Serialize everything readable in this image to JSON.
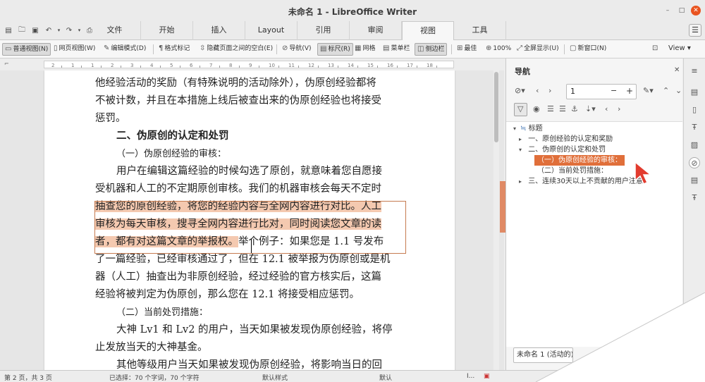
{
  "window": {
    "title": "未命名 1 - LibreOffice Writer"
  },
  "tabs": [
    "文件",
    "开始",
    "插入",
    "Layout",
    "引用",
    "审阅",
    "视图",
    "工具"
  ],
  "toolbar": {
    "normal_view": "普通视图(N)",
    "web_view": "网页视图(W)",
    "edit_mode": "编辑模式(D)",
    "formatting_marks": "格式标记",
    "hide_whitespace": "隐藏页面之间的空白(E)",
    "navigator": "导航(V)",
    "rulers": "标尺(R)",
    "grid": "网格",
    "menubar": "菜单栏",
    "sidebar": "侧边栏",
    "optimal": "最佳",
    "zoom100": "100%",
    "fullscreen": "全屏显示(U)",
    "new_window": "新窗口(N)",
    "view_menu": "View"
  },
  "ruler": {
    "labels": [
      "2",
      "1",
      "1",
      "2",
      "3",
      "4",
      "5",
      "6",
      "7",
      "8",
      "9",
      "10",
      "11",
      "12",
      "13",
      "14",
      "15",
      "16",
      "17",
      "18"
    ]
  },
  "document": {
    "line1": "他经验活动的奖励（有特殊说明的活动除外），伪原创经验都将",
    "line2": "不被计数，并且在本措施上线后被查出来的伪原创经验也将接受",
    "line3": "惩罚。",
    "heading2": "二、伪原创的认定和处罚",
    "heading3a": "（一）伪原创经验的审核：",
    "p2_1": "用户在编辑这篇经验的时候勾选了原创，就意味着您自愿接",
    "p2_2": "受机器和人工的不定期原创审核。我们的机器审核会每天不定时",
    "p2_3": "抽查您的原创经验，将您的经验内容与全网内容进行对比。人工",
    "p2_4": "审核为每天审核，搜寻全网内容进行比对，同时阅读您文章的读",
    "p2_5_sel": "者，都有对这篇文章的举报权。",
    "p2_5_rest": "举个例子：如果您是 1.1 号发布",
    "p2_6": "了一篇经验，已经审核通过了，但在 12.1 被举报为伪原创或是机",
    "p2_7": "器（人工）抽查出为非原创经验，经过经验的官方核实后，这篇",
    "p2_8": "经验将被判定为伪原创，那么您在 12.1 将接受相应惩罚。",
    "heading3b": "（二）当前处罚措施：",
    "p3_1": "大神 Lv1 和 Lv2 的用户，当天如果被发现伪原创经验，将停",
    "p3_2": "止发放当天的大神基金。",
    "p4_1": "其他等级用户当天如果被发现伪原创经验，将影响当日的回"
  },
  "navigator": {
    "title": "导航",
    "page_value": "1",
    "tree_root": "标题",
    "items": [
      "一、原创经验的认定和奖励",
      "二、伪原创的认定和处罚",
      "（一）伪原创经验的审核：",
      "（二）当前处罚措施：",
      "三、连续30天以上不贡献的用户注意"
    ],
    "doc_select": "未命名 1 (活动的)"
  },
  "status": {
    "page": "第 2 页，共 3 页",
    "selection": "已选择：70 个字词，70 个字符",
    "page_style": "默认样式",
    "language": "默认",
    "insert_mode": "I..."
  },
  "colors": {
    "accent": "#e06f3a",
    "highlight": "#f4c9b0",
    "close_button": "#e95420"
  }
}
